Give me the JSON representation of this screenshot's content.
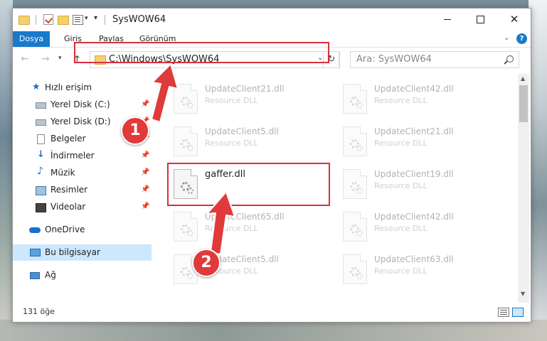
{
  "window": {
    "title": "SysWOW64"
  },
  "ribbon": {
    "tabs": [
      "Dosya",
      "Giriş",
      "Paylaş",
      "Görünüm"
    ],
    "help": "?"
  },
  "address": {
    "path": "C:\\Windows\\SysWOW64"
  },
  "search": {
    "placeholder": "Ara: SysWOW64"
  },
  "sidebar": {
    "items": [
      {
        "label": "Hızlı erişim",
        "icon": "star-icon",
        "pinned": false
      },
      {
        "label": "Yerel Disk (C:)",
        "icon": "drive-icon",
        "pinned": true
      },
      {
        "label": "Yerel Disk (D:)",
        "icon": "drive-icon",
        "pinned": true
      },
      {
        "label": "Belgeler",
        "icon": "documents-icon",
        "pinned": true
      },
      {
        "label": "İndirmeler",
        "icon": "download-icon",
        "pinned": true
      },
      {
        "label": "Müzik",
        "icon": "music-icon",
        "pinned": true
      },
      {
        "label": "Resimler",
        "icon": "pictures-icon",
        "pinned": true
      },
      {
        "label": "Videolar",
        "icon": "videos-icon",
        "pinned": true
      },
      {
        "label": "OneDrive",
        "icon": "onedrive-icon",
        "pinned": false
      },
      {
        "label": "Bu bilgisayar",
        "icon": "this-pc-icon",
        "pinned": false,
        "selected": true
      },
      {
        "label": "Ağ",
        "icon": "network-icon",
        "pinned": false
      }
    ]
  },
  "files": {
    "left": [
      {
        "name": "UpdateClient21.dll",
        "type": "Resource DLL"
      },
      {
        "name": "UpdateClient5.dll",
        "type": "Resource DLL"
      },
      {
        "name": "gaffer.dll",
        "type": ""
      },
      {
        "name": "UpdateClient65.dll",
        "type": "Resource DLL"
      },
      {
        "name": "UpdateClient5.dll",
        "type": "Resource DLL"
      }
    ],
    "right": [
      {
        "name": "UpdateClient42.dll",
        "type": "Resource DLL"
      },
      {
        "name": "UpdateClient21.dll",
        "type": "Resource DLL"
      },
      {
        "name": "UpdateClient19.dll",
        "type": "Resource DLL"
      },
      {
        "name": "UpdateClient42.dll",
        "type": "Resource DLL"
      },
      {
        "name": "UpdateClient63.dll",
        "type": "Resource DLL"
      }
    ]
  },
  "status": {
    "text": "131 öğe"
  },
  "callouts": [
    "1",
    "2"
  ],
  "colors": {
    "accent": "#1979ca",
    "highlight": "#d8303d",
    "selected_bg": "#cce8ff"
  }
}
